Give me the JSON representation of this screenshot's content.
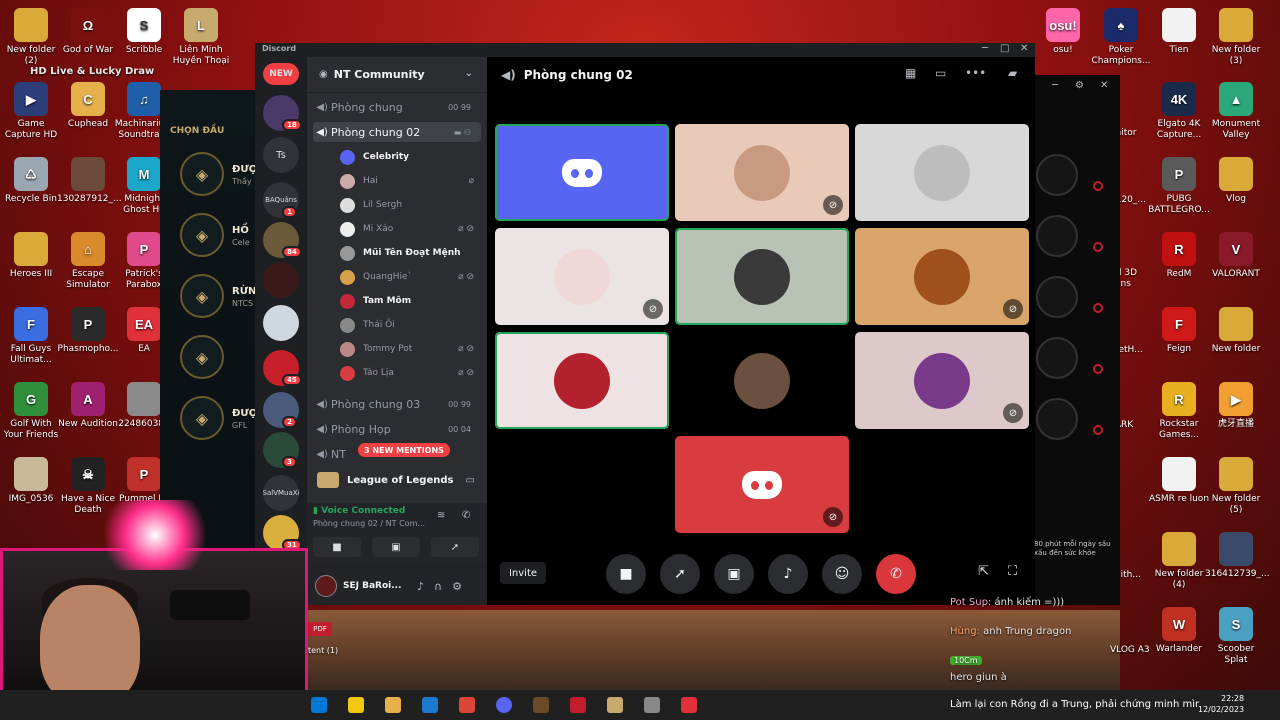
{
  "stream": {
    "tag": "HD Live & Lucky Draw"
  },
  "desktop_left": [
    {
      "label": "New folder (2)",
      "color": "#d9a93a",
      "glyph": ""
    },
    {
      "label": "God of War",
      "color": "#7a1010",
      "glyph": "Ω"
    },
    {
      "label": "Scribble",
      "color": "#ffffff",
      "glyph": "S"
    },
    {
      "label": "Game Capture HD",
      "color": "#2c3e7a",
      "glyph": "▶"
    },
    {
      "label": "Cuphead",
      "color": "#e3b04b",
      "glyph": "C"
    },
    {
      "label": "Machinarium Soundtrack",
      "color": "#1d5fa8",
      "glyph": "♫"
    },
    {
      "label": "Recycle Bin",
      "color": "#9aa6b2",
      "glyph": "♺"
    },
    {
      "label": "130287912_...",
      "color": "#6b4a3a",
      "glyph": ""
    },
    {
      "label": "Midnight Ghost Hu",
      "color": "#1aa7c9",
      "glyph": "M"
    },
    {
      "label": "Heroes III",
      "color": "#d9a93a",
      "glyph": ""
    },
    {
      "label": "Escape Simulator",
      "color": "#d98a2a",
      "glyph": "⌂"
    },
    {
      "label": "Patrick's Parabox",
      "color": "#e04a8a",
      "glyph": "P"
    },
    {
      "label": "Fall Guys Ultimat...",
      "color": "#3a6ee0",
      "glyph": "F"
    },
    {
      "label": "Phasmopho...",
      "color": "#2a2a2a",
      "glyph": "P"
    },
    {
      "label": "EA",
      "color": "#e0303a",
      "glyph": "EA"
    },
    {
      "label": "Golf With Your Friends",
      "color": "#2f8f3a",
      "glyph": "G"
    },
    {
      "label": "New Audition",
      "color": "#a02070",
      "glyph": "A"
    },
    {
      "label": "224860383",
      "color": "#8a8a8a",
      "glyph": ""
    },
    {
      "label": "IMG_0536",
      "color": "#c9b89a",
      "glyph": ""
    },
    {
      "label": "Have a Nice Death",
      "color": "#222222",
      "glyph": "☠"
    },
    {
      "label": "Pummel Pa",
      "color": "#c0302a",
      "glyph": "P"
    }
  ],
  "desktop_top": [
    {
      "label": "Liên Minh Huyền Thoại",
      "color": "#c8aa6e",
      "glyph": "L"
    },
    {
      "label": "osu!",
      "color": "#ff66aa",
      "glyph": "osu!"
    },
    {
      "label": "Poker Champions...",
      "color": "#1a2a6a",
      "glyph": "♠"
    },
    {
      "label": "Tien",
      "color": "#f2f2f2",
      "glyph": ""
    },
    {
      "label": "New folder (3)",
      "color": "#d9a93a",
      "glyph": ""
    }
  ],
  "desktop_right": [
    {
      "label": "Elgato 4K Capture...",
      "color": "#1a2a4a",
      "glyph": "4K"
    },
    {
      "label": "Monument Valley",
      "color": "#2aa87a",
      "glyph": "▲"
    },
    {
      "label": "PUBG BATTLEGRO...",
      "color": "#5a5a5a",
      "glyph": "P"
    },
    {
      "label": "Vlog",
      "color": "#d9a93a",
      "glyph": ""
    },
    {
      "label": "RedM",
      "color": "#c01010",
      "glyph": "R"
    },
    {
      "label": "VALORANT",
      "color": "#8a1a2a",
      "glyph": "V"
    },
    {
      "label": "Feign",
      "color": "#d01a1a",
      "glyph": "F"
    },
    {
      "label": "New folder",
      "color": "#d9a93a",
      "glyph": ""
    },
    {
      "label": "Rockstar Games...",
      "color": "#e8b020",
      "glyph": "R"
    },
    {
      "label": "虎牙直播",
      "color": "#f0a030",
      "glyph": "▶"
    },
    {
      "label": "ASMR re luon",
      "color": "#f2f2f2",
      "glyph": ""
    },
    {
      "label": "New folder (5)",
      "color": "#d9a93a",
      "glyph": ""
    },
    {
      "label": "New folder (4)",
      "color": "#d9a93a",
      "glyph": ""
    },
    {
      "label": "316412739_...",
      "color": "#3a4a6a",
      "glyph": ""
    },
    {
      "label": "Warlander",
      "color": "#c03020",
      "glyph": "W"
    },
    {
      "label": "Scoober Splat",
      "color": "#4aa0c0",
      "glyph": "S"
    }
  ],
  "desktop_partial": [
    {
      "label": "onitor"
    },
    {
      "label": "3120_..."
    },
    {
      "label": "rol 3D lians"
    },
    {
      "label": "VietH..."
    },
    {
      "label": "PARK"
    },
    {
      "label": "id"
    },
    {
      "label": "-with..."
    },
    {
      "label": "VLOG A3"
    }
  ],
  "lol": {
    "section_title": "CHỌN ĐẦU",
    "rows": [
      {
        "name": "ĐƯỢC",
        "sub": "Thầy"
      },
      {
        "name": "HỒ",
        "sub": "Cele"
      },
      {
        "name": "RỪN",
        "sub": "NTCS"
      },
      {
        "name": "",
        "sub": ""
      },
      {
        "name": "ĐƯỢ",
        "sub": "GFL"
      }
    ]
  },
  "discord": {
    "brand": "Discord",
    "guilds": [
      {
        "label": "NEW",
        "badge": ""
      },
      {
        "label": "",
        "badge": "18"
      },
      {
        "label": "Ts",
        "badge": ""
      },
      {
        "label": "BAQuâns",
        "badge": "1"
      },
      {
        "label": "",
        "badge": "84"
      },
      {
        "label": "",
        "badge": ""
      },
      {
        "label": "",
        "badge": ""
      },
      {
        "label": "",
        "badge": "45"
      },
      {
        "label": "",
        "badge": "2"
      },
      {
        "label": "",
        "badge": "3"
      },
      {
        "label": "SalVMuaXi",
        "badge": ""
      },
      {
        "label": "",
        "badge": "31"
      }
    ],
    "server_name": "NT Community",
    "channels": [
      {
        "name": "Phòng chung",
        "meta": "00 99",
        "active": false
      },
      {
        "name": "Phòng chung 02",
        "meta": "",
        "active": true
      }
    ],
    "members": [
      {
        "name": "Celebrity",
        "bold": true,
        "color": "#5865f2",
        "mic": ""
      },
      {
        "name": "Hai",
        "bold": false,
        "color": "#caa",
        "mic": "⌀"
      },
      {
        "name": "Lil Sergh",
        "bold": false,
        "color": "#ddd",
        "mic": ""
      },
      {
        "name": "Mi Xáo",
        "bold": false,
        "color": "#eee",
        "mic": "⌀ ⊘"
      },
      {
        "name": "Mũi Tên Đoạt Mệnh",
        "bold": true,
        "color": "#999",
        "mic": ""
      },
      {
        "name": "QuangHie`",
        "bold": false,
        "color": "#d7a04a",
        "mic": "⌀ ⊘"
      },
      {
        "name": "Tam Môm",
        "bold": true,
        "color": "#c3283a",
        "mic": ""
      },
      {
        "name": "Thái Ôi",
        "bold": false,
        "color": "#888",
        "mic": ""
      },
      {
        "name": "Tommy Pot",
        "bold": false,
        "color": "#b88",
        "mic": "⌀ ⊘"
      },
      {
        "name": "Táo Lịa",
        "bold": false,
        "color": "#d83c3e",
        "mic": "⌀ ⊘"
      }
    ],
    "channels_after": [
      {
        "name": "Phòng chung 03",
        "meta": "00 99"
      },
      {
        "name": "Phòng Họp",
        "meta": "00 04"
      },
      {
        "name": "NT",
        "meta": ""
      }
    ],
    "new_mentions": "3 NEW MENTIONS",
    "category_lol": "League of Legends",
    "voice": {
      "status": "Voice Connected",
      "channel": "Phòng chung 02 / NT Com..."
    },
    "user": {
      "name": "SEJ BaRoi..."
    },
    "stage_title": "Phòng chung 02",
    "tiles": [
      {
        "kind": "discord-blue",
        "muted": false,
        "speaking": true
      },
      {
        "kind": "avatar",
        "color": "#e9c9b8",
        "avatar": "#c99a82",
        "muted": true
      },
      {
        "kind": "avatar",
        "color": "#d8d8d8",
        "avatar": "#bdbdbd",
        "muted": false
      },
      {
        "kind": "avatar",
        "color": "#ece4e4",
        "avatar": "#f0d8d8",
        "muted": true
      },
      {
        "kind": "avatar",
        "color": "#b9c2b4",
        "avatar": "#3a3a3a",
        "muted": false,
        "speaking": true
      },
      {
        "kind": "avatar",
        "color": "#d9a56a",
        "avatar": "#a0501a",
        "muted": true
      },
      {
        "kind": "avatar",
        "color": "#efe2e2",
        "avatar": "#b3202e",
        "muted": false,
        "speaking": true
      },
      {
        "kind": "avatar",
        "color": "#000000",
        "avatar": "#6b5040",
        "muted": false
      },
      {
        "kind": "avatar",
        "color": "#ddc9c9",
        "avatar": "#7a3a8a",
        "muted": true
      },
      {
        "kind": "discord-red",
        "muted": true
      }
    ],
    "invite_label": "Invite"
  },
  "chat": [
    {
      "name": "Pot Sup:",
      "text": " ánh kiếm =)))",
      "level": ""
    },
    {
      "name": "Hùng:",
      "text": " anh Trung dragon",
      "level": ""
    },
    {
      "name": "",
      "text": "",
      "level": "10Cm"
    },
    {
      "name": "",
      "text": "hero giun à",
      "level": ""
    }
  ],
  "dim_note": "80 phút mỗi ngày sấu xấu đến sức khỏe",
  "taskbar": {
    "time": "22:28",
    "date": "12/02/2023",
    "news": "Làm lại con Rồng đi a Trung, phải chứng minh mìr"
  },
  "webcam_file": {
    "label": "tent (1)"
  }
}
